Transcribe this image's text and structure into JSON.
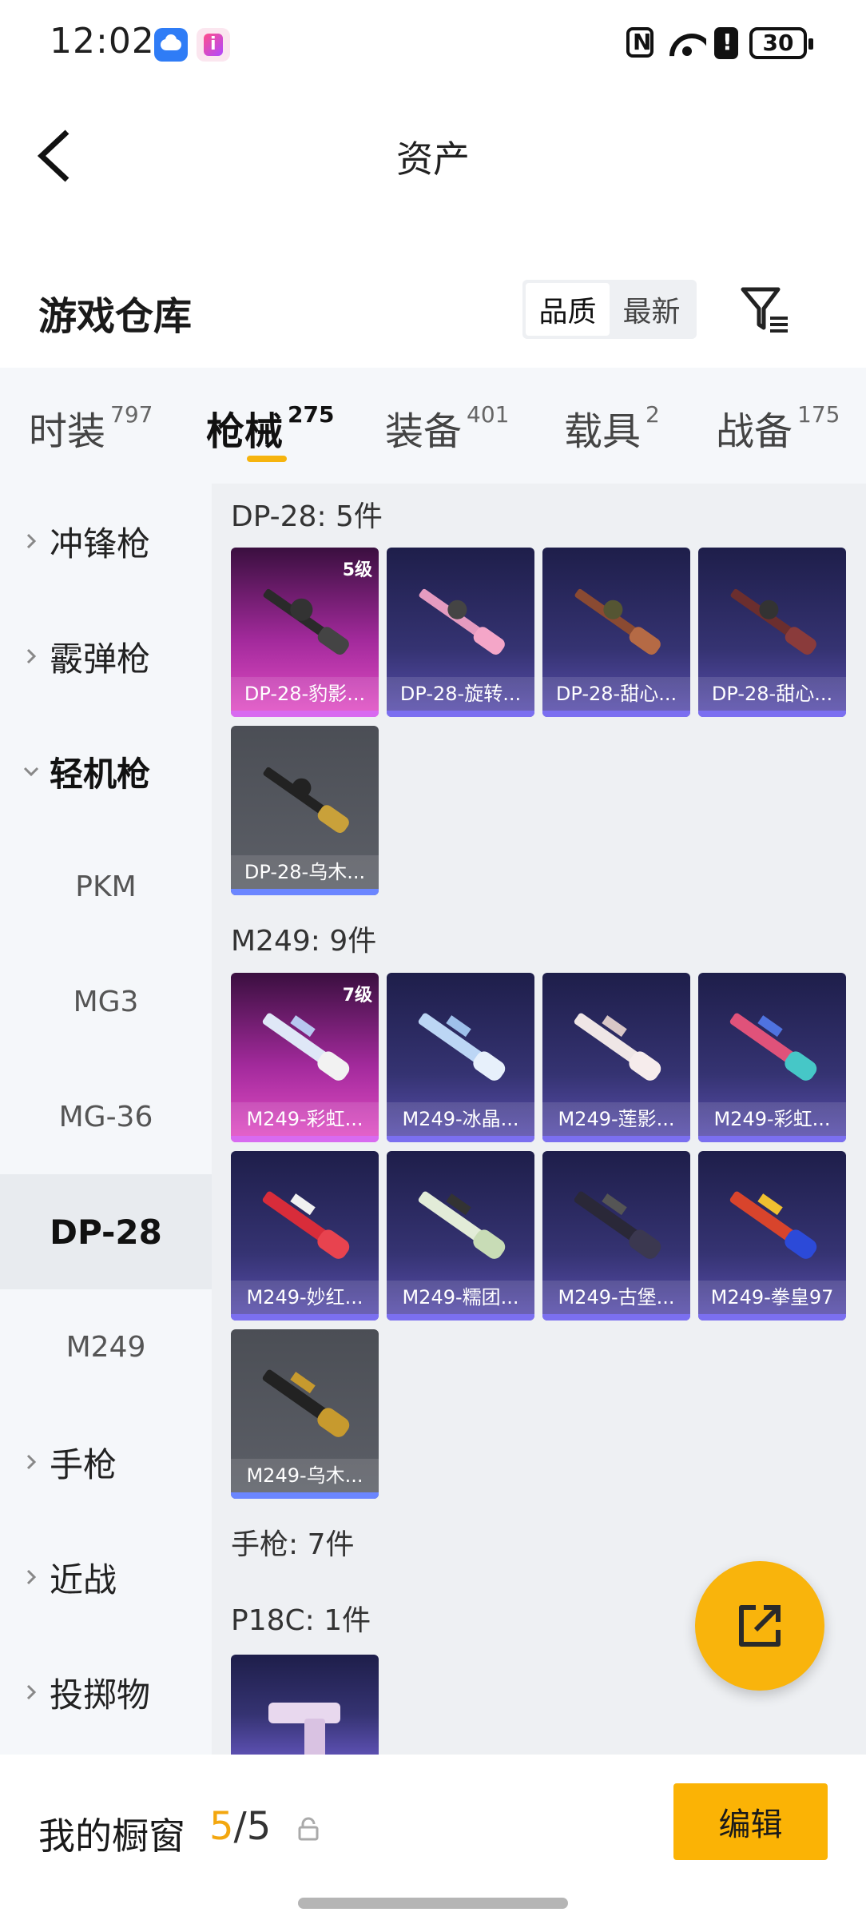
{
  "status_bar": {
    "time": "12:02",
    "battery": "30"
  },
  "header": {
    "title": "资产"
  },
  "section": {
    "title": "游戏仓库",
    "sort_options": [
      "品质",
      "最新"
    ]
  },
  "category_tabs": [
    {
      "label": "时装",
      "count": "797"
    },
    {
      "label": "枪械",
      "count": "275"
    },
    {
      "label": "装备",
      "count": "401"
    },
    {
      "label": "载具",
      "count": "2"
    },
    {
      "label": "战备",
      "count": "175"
    }
  ],
  "side_menu": [
    {
      "label": "冲锋枪"
    },
    {
      "label": "霰弹枪"
    },
    {
      "label": "轻机枪"
    },
    {
      "label": "PKM"
    },
    {
      "label": "MG3"
    },
    {
      "label": "MG-36"
    },
    {
      "label": "DP-28"
    },
    {
      "label": "M249"
    },
    {
      "label": "手枪"
    },
    {
      "label": "近战"
    },
    {
      "label": "投掷物"
    }
  ],
  "groups": [
    {
      "title": "DP-28: 5件",
      "items": [
        {
          "name": "DP-28-豹影...",
          "level": "5级",
          "tier": "pink"
        },
        {
          "name": "DP-28-旋转...",
          "tier": "purple"
        },
        {
          "name": "DP-28-甜心...",
          "tier": "purple"
        },
        {
          "name": "DP-28-甜心...",
          "tier": "purple"
        },
        {
          "name": "DP-28-乌木...",
          "tier": "grey"
        }
      ]
    },
    {
      "title": "M249: 9件",
      "items": [
        {
          "name": "M249-彩虹...",
          "level": "7级",
          "tier": "pink"
        },
        {
          "name": "M249-冰晶...",
          "tier": "purple"
        },
        {
          "name": "M249-莲影...",
          "tier": "purple"
        },
        {
          "name": "M249-彩虹...",
          "tier": "purple"
        },
        {
          "name": "M249-妙红...",
          "tier": "purple"
        },
        {
          "name": "M249-糯团...",
          "tier": "purple"
        },
        {
          "name": "M249-古堡...",
          "tier": "purple"
        },
        {
          "name": "M249-拳皇97",
          "tier": "purple"
        },
        {
          "name": "M249-乌木...",
          "tier": "grey"
        }
      ]
    },
    {
      "title": "手枪: 7件"
    },
    {
      "title": "P18C: 1件"
    }
  ],
  "bottom_bar": {
    "label": "我的橱窗",
    "count": "5",
    "total": "5",
    "edit_label": "编辑"
  },
  "colors": {
    "accent": "#f6b40e",
    "pink_tier": "#a32a9c",
    "purple_tier": "#353372",
    "grey_tier": "#5d6068"
  }
}
